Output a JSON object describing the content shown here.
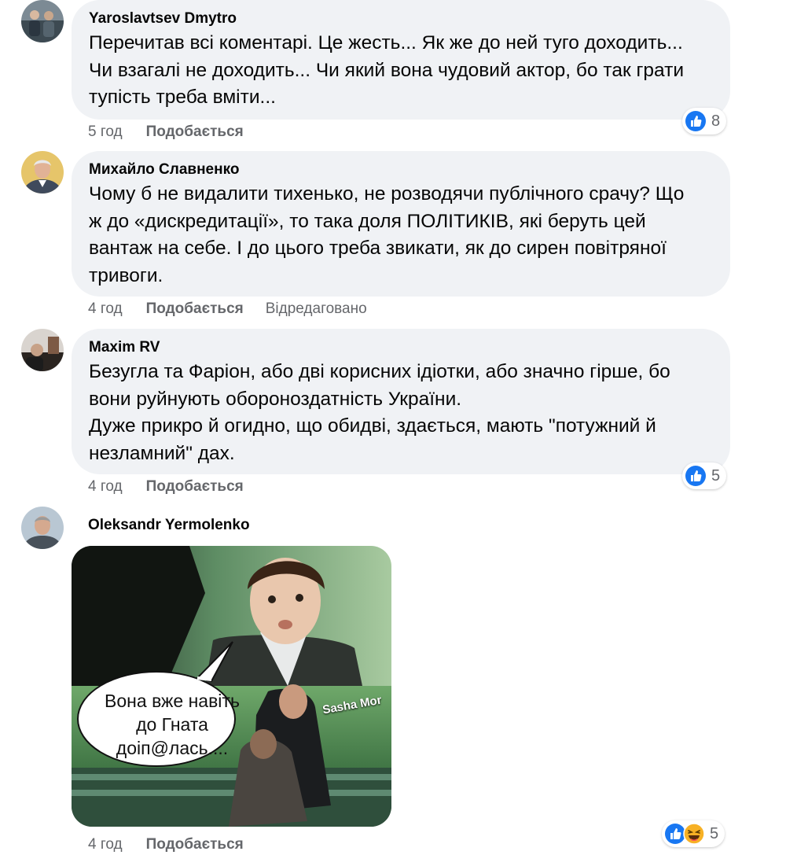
{
  "comments": [
    {
      "author": "Yaroslavtsev Dmytro",
      "text": "Перечитав всі коментарі. Це жесть... Як же до ней туго доходить...\nЧи взагалі не доходить... Чи який вона чудовий актор, бо так грати\nтупість треба вміти...",
      "time": "5 год",
      "like_label": "Подобається",
      "reactions": {
        "icons": [
          "like-icon"
        ],
        "count": "8"
      }
    },
    {
      "author": "Михайло Славненко",
      "text": "Чому б не видалити тихенько, не розводячи публічного срачу? Що\nж до «дискредитації», то така доля ПОЛІТИКІВ, які беруть цей\nвантаж на себе. І до цього треба звикати, як до сирен повітряної\nтривоги.",
      "time": "4 год",
      "like_label": "Подобається",
      "edited_label": "Відредаговано"
    },
    {
      "author": "Maxim RV",
      "text": "Безугла та Фаріон, або дві корисних ідіотки, або значно гірше, бо\nвони руйнують обороноздатність України.\nДуже прикро й огидно, що обидві, здається, мають \"потужний й\nнезламний\" дах.",
      "time": "4 год",
      "like_label": "Подобається",
      "reactions": {
        "icons": [
          "like-icon"
        ],
        "count": "5"
      }
    },
    {
      "author": "Oleksandr Yermolenko",
      "image": {
        "speech_bubble_text": [
          "Вона вже навіть",
          "до Гната",
          "доіп@лась...."
        ],
        "watermark": "Sasha Mor"
      },
      "time": "4 год",
      "like_label": "Подобається",
      "reactions": {
        "icons": [
          "like-icon",
          "laughing-face-icon"
        ],
        "count": "5"
      }
    }
  ],
  "colors": {
    "bubble_bg": "#f0f2f5",
    "meta_text": "#65676b",
    "like_blue": "#1877f2",
    "haha_yellow": "#f7b125"
  }
}
